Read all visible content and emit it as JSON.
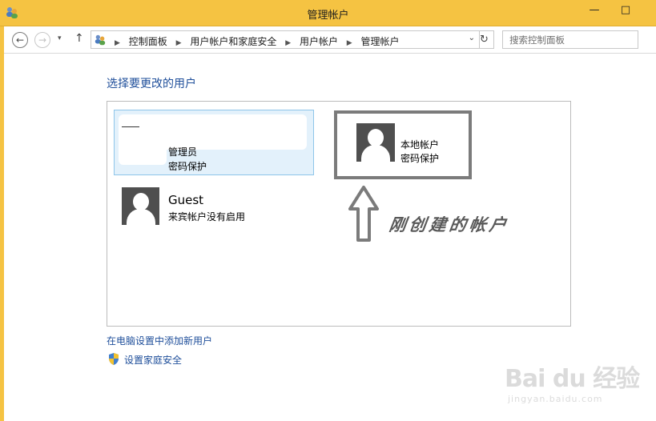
{
  "window": {
    "title": "管理帐户",
    "minimize_glyph": "—",
    "maximize_glyph": "□"
  },
  "navigation": {
    "back_glyph": "←",
    "forward_glyph": "→",
    "recent_glyph": "▾",
    "up_glyph": "↑",
    "breadcrumbs": [
      "控制面板",
      "用户帐户和家庭安全",
      "用户帐户",
      "管理帐户"
    ],
    "breadcrumb_separator": "▶",
    "address_dropdown_glyph": "⌄",
    "refresh_glyph": "↻",
    "search_placeholder": "搜索控制面板"
  },
  "main": {
    "heading": "选择要更改的用户",
    "accounts": [
      {
        "id": "admin",
        "name": "",
        "lines": [
          "管理员",
          "密码保护"
        ],
        "selected": true
      },
      {
        "id": "guest",
        "name": "Guest",
        "lines": [
          "来宾帐户没有启用"
        ],
        "selected": false
      },
      {
        "id": "local",
        "name": "",
        "lines": [
          "本地帐户",
          "密码保护"
        ],
        "selected": false
      }
    ],
    "annotation": "刚创建的帐户"
  },
  "links": {
    "add_user": "在电脑设置中添加新用户",
    "family_safety": "设置家庭安全"
  },
  "watermark": {
    "main": "Bai du 经验",
    "sub": "jingyan.baidu.com"
  },
  "icons": {
    "app": "users-control-panel-icon",
    "user_picture": "user-silhouette-icon",
    "shield": "uac-shield-icon"
  },
  "colors": {
    "titlebar": "#f5c342",
    "link": "#1e4e9a",
    "selection_fill": "#e3f1fb",
    "selection_border": "#8ec5ea",
    "avatar": "#4f4f4f",
    "annotation": "#7b7b7b"
  }
}
